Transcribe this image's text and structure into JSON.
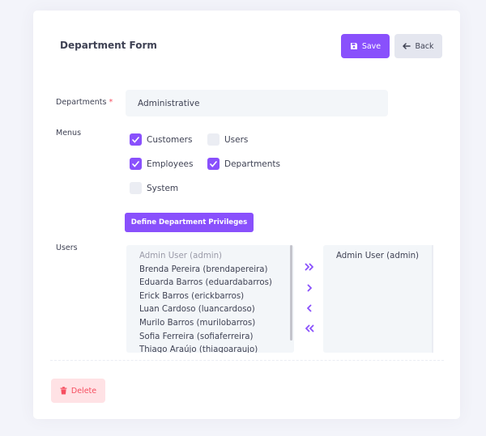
{
  "form": {
    "title": "Department Form",
    "save_label": "Save",
    "back_label": "Back",
    "departments_label": "Departments",
    "required_mark": "*",
    "department_value": "Administrative",
    "menus_label": "Menus",
    "users_label": "Users",
    "define_privileges_label": "Define Department Privileges",
    "delete_label": "Delete"
  },
  "menus": [
    {
      "label": "Customers",
      "checked": true
    },
    {
      "label": "Users",
      "checked": false
    },
    {
      "label": "Employees",
      "checked": true
    },
    {
      "label": "Departments",
      "checked": true
    },
    {
      "label": "System",
      "checked": false
    }
  ],
  "available_users": [
    "Admin User (admin)",
    "Brenda Pereira (brendapereira)",
    "Eduarda Barros (eduardabarros)",
    "Erick Barros (erickbarros)",
    "Luan Cardoso (luancardoso)",
    "Murilo Barros (murilobarros)",
    "Sofia Ferreira (sofiaferreira)",
    "Thiago Araújo (thiagoaraujo)"
  ],
  "selected_users": [
    "Admin User (admin)"
  ],
  "colors": {
    "primary": "#8950fc",
    "danger": "#f64e60",
    "danger_light": "#ffe2e5",
    "secondary": "#e4e6ef"
  },
  "icons": {
    "save": "floppy-disk-icon",
    "back": "arrow-left-icon",
    "delete": "trash-icon",
    "move_all_right": "double-chevron-right-icon",
    "move_right": "chevron-right-icon",
    "move_left": "chevron-left-icon",
    "move_all_left": "double-chevron-left-icon"
  }
}
